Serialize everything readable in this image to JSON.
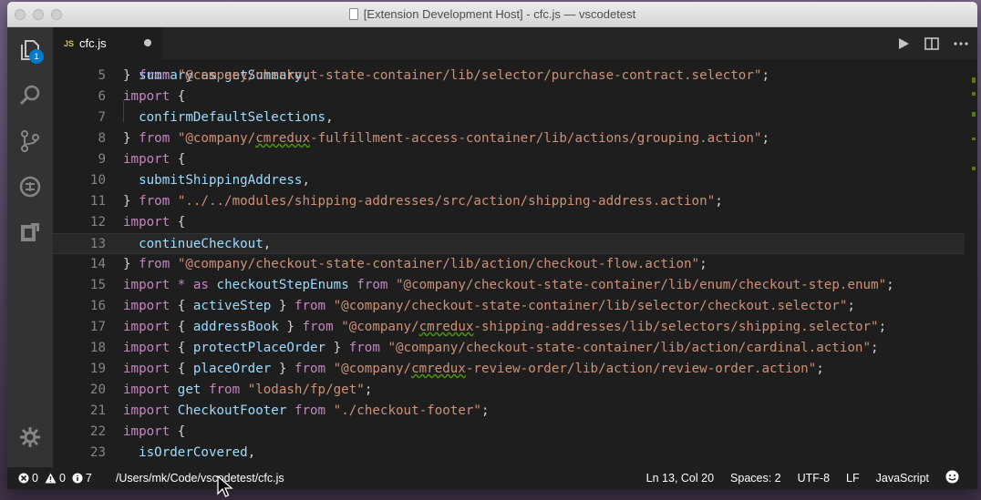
{
  "window": {
    "title": "[Extension Development Host] - cfc.js — vscodetest"
  },
  "activity_bar": {
    "items": [
      {
        "name": "explorer",
        "icon": "files-icon",
        "badge": "1"
      },
      {
        "name": "search",
        "icon": "search-icon"
      },
      {
        "name": "scm",
        "icon": "source-control-icon"
      },
      {
        "name": "debug",
        "icon": "debug-icon"
      },
      {
        "name": "extensions",
        "icon": "extensions-icon"
      }
    ],
    "settings_icon": "gear-icon"
  },
  "tab": {
    "lang": "JS",
    "name": "cfc.js",
    "dirty": true
  },
  "editor_actions": [
    "run-icon",
    "split-editor-icon",
    "more-icon"
  ],
  "editor": {
    "top_partial": "  summary as getSummary,",
    "current_line": 13,
    "lines": [
      {
        "n": "5",
        "tokens": [
          [
            "p",
            "} "
          ],
          [
            "k",
            "from"
          ],
          [
            "p",
            " "
          ],
          [
            "s",
            "\"@company/checkout-state-container/lib/selector/purchase-contract.selector\""
          ],
          [
            "p",
            ";"
          ]
        ]
      },
      {
        "n": "6",
        "tokens": [
          [
            "k",
            "import"
          ],
          [
            "p",
            " {"
          ]
        ]
      },
      {
        "n": "7",
        "tokens": [
          [
            "p",
            "  "
          ],
          [
            "v",
            "confirmDefaultSelections"
          ],
          [
            "p",
            ","
          ]
        ]
      },
      {
        "n": "8",
        "tokens": [
          [
            "p",
            "} "
          ],
          [
            "k",
            "from"
          ],
          [
            "p",
            " "
          ],
          [
            "s",
            "\"@company/"
          ],
          [
            "sq",
            "cmredux"
          ],
          [
            "s",
            "-fulfillment-access-container/lib/actions/grouping.action\""
          ],
          [
            "p",
            ";"
          ]
        ]
      },
      {
        "n": "9",
        "tokens": [
          [
            "k",
            "import"
          ],
          [
            "p",
            " {"
          ]
        ]
      },
      {
        "n": "10",
        "tokens": [
          [
            "p",
            "  "
          ],
          [
            "v",
            "submitShippingAddress"
          ],
          [
            "p",
            ","
          ]
        ]
      },
      {
        "n": "11",
        "tokens": [
          [
            "p",
            "} "
          ],
          [
            "k",
            "from"
          ],
          [
            "p",
            " "
          ],
          [
            "s",
            "\"../../modules/shipping-addresses/src/action/shipping-address.action\""
          ],
          [
            "p",
            ";"
          ]
        ]
      },
      {
        "n": "12",
        "tokens": [
          [
            "k",
            "import"
          ],
          [
            "p",
            " {"
          ]
        ]
      },
      {
        "n": "13",
        "tokens": [
          [
            "p",
            "  "
          ],
          [
            "v",
            "continueCheckout"
          ],
          [
            "p",
            ","
          ]
        ]
      },
      {
        "n": "14",
        "tokens": [
          [
            "p",
            "} "
          ],
          [
            "k",
            "from"
          ],
          [
            "p",
            " "
          ],
          [
            "s",
            "\"@company/checkout-state-container/lib/action/checkout-flow.action\""
          ],
          [
            "p",
            ";"
          ]
        ]
      },
      {
        "n": "15",
        "tokens": [
          [
            "k",
            "import"
          ],
          [
            "p",
            " "
          ],
          [
            "k",
            "*"
          ],
          [
            "p",
            " "
          ],
          [
            "k",
            "as"
          ],
          [
            "p",
            " "
          ],
          [
            "v",
            "checkoutStepEnums"
          ],
          [
            "p",
            " "
          ],
          [
            "k",
            "from"
          ],
          [
            "p",
            " "
          ],
          [
            "s",
            "\"@company/checkout-state-container/lib/enum/checkout-step.enum\""
          ],
          [
            "p",
            ";"
          ]
        ]
      },
      {
        "n": "16",
        "tokens": [
          [
            "k",
            "import"
          ],
          [
            "p",
            " { "
          ],
          [
            "v",
            "activeStep"
          ],
          [
            "p",
            " } "
          ],
          [
            "k",
            "from"
          ],
          [
            "p",
            " "
          ],
          [
            "s",
            "\"@company/checkout-state-container/lib/selector/checkout.selector\""
          ],
          [
            "p",
            ";"
          ]
        ]
      },
      {
        "n": "17",
        "tokens": [
          [
            "k",
            "import"
          ],
          [
            "p",
            " { "
          ],
          [
            "v",
            "addressBook"
          ],
          [
            "p",
            " } "
          ],
          [
            "k",
            "from"
          ],
          [
            "p",
            " "
          ],
          [
            "s",
            "\"@company/"
          ],
          [
            "sq",
            "cmredux"
          ],
          [
            "s",
            "-shipping-addresses/lib/selectors/shipping.selector\""
          ],
          [
            "p",
            ";"
          ]
        ]
      },
      {
        "n": "18",
        "tokens": [
          [
            "k",
            "import"
          ],
          [
            "p",
            " { "
          ],
          [
            "v",
            "protectPlaceOrder"
          ],
          [
            "p",
            " } "
          ],
          [
            "k",
            "from"
          ],
          [
            "p",
            " "
          ],
          [
            "s",
            "\"@company/checkout-state-container/lib/action/cardinal.action\""
          ],
          [
            "p",
            ";"
          ]
        ]
      },
      {
        "n": "19",
        "tokens": [
          [
            "k",
            "import"
          ],
          [
            "p",
            " { "
          ],
          [
            "v",
            "placeOrder"
          ],
          [
            "p",
            " } "
          ],
          [
            "k",
            "from"
          ],
          [
            "p",
            " "
          ],
          [
            "s",
            "\"@company/"
          ],
          [
            "sq",
            "cmredux"
          ],
          [
            "s",
            "-review-order/lib/action/review-order.action\""
          ],
          [
            "p",
            ";"
          ]
        ]
      },
      {
        "n": "20",
        "tokens": [
          [
            "k",
            "import"
          ],
          [
            "p",
            " "
          ],
          [
            "v",
            "get"
          ],
          [
            "p",
            " "
          ],
          [
            "k",
            "from"
          ],
          [
            "p",
            " "
          ],
          [
            "s",
            "\"lodash/fp/get\""
          ],
          [
            "p",
            ";"
          ]
        ]
      },
      {
        "n": "21",
        "tokens": [
          [
            "k",
            "import"
          ],
          [
            "p",
            " "
          ],
          [
            "v",
            "CheckoutFooter"
          ],
          [
            "p",
            " "
          ],
          [
            "k",
            "from"
          ],
          [
            "p",
            " "
          ],
          [
            "s",
            "\"./checkout-footer\""
          ],
          [
            "p",
            ";"
          ]
        ]
      },
      {
        "n": "22",
        "tokens": [
          [
            "k",
            "import"
          ],
          [
            "p",
            " {"
          ]
        ]
      },
      {
        "n": "23",
        "tokens": [
          [
            "p",
            "  "
          ],
          [
            "v",
            "isOrderCovered"
          ],
          [
            "p",
            ","
          ]
        ]
      }
    ]
  },
  "status_bar": {
    "errors": "0",
    "warnings": "0",
    "info": "7",
    "path": "/Users/mk/Code/vscodetest/cfc.js",
    "position": "Ln 13, Col 20",
    "spaces": "Spaces: 2",
    "encoding": "UTF-8",
    "eol": "LF",
    "language": "JavaScript",
    "feedback_icon": "smiley-icon"
  }
}
